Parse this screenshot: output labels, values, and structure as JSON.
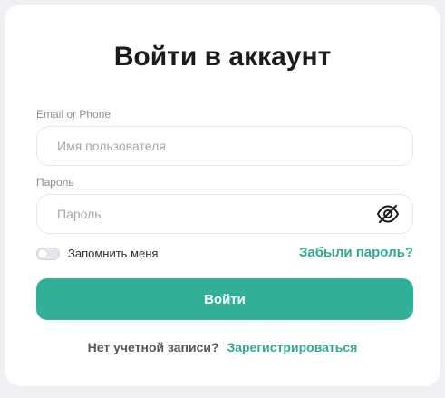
{
  "title": "Войти в аккаунт",
  "username": {
    "label": "Email or Phone",
    "placeholder": "Имя пользователя",
    "value": ""
  },
  "password": {
    "label": "Пароль",
    "placeholder": "Пароль",
    "value": "",
    "toggle_icon": "eye-off-icon"
  },
  "remember": {
    "label": "Запомнить меня",
    "checked": false
  },
  "forgot_link": "Забыли пароль?",
  "login_button": "Войти",
  "signup": {
    "prompt": "Нет учетной записи?",
    "link": "Зарегистрироваться"
  },
  "colors": {
    "accent": "#32b097",
    "link": "#2faa91",
    "background": "#eef0f3",
    "card": "#ffffff"
  }
}
